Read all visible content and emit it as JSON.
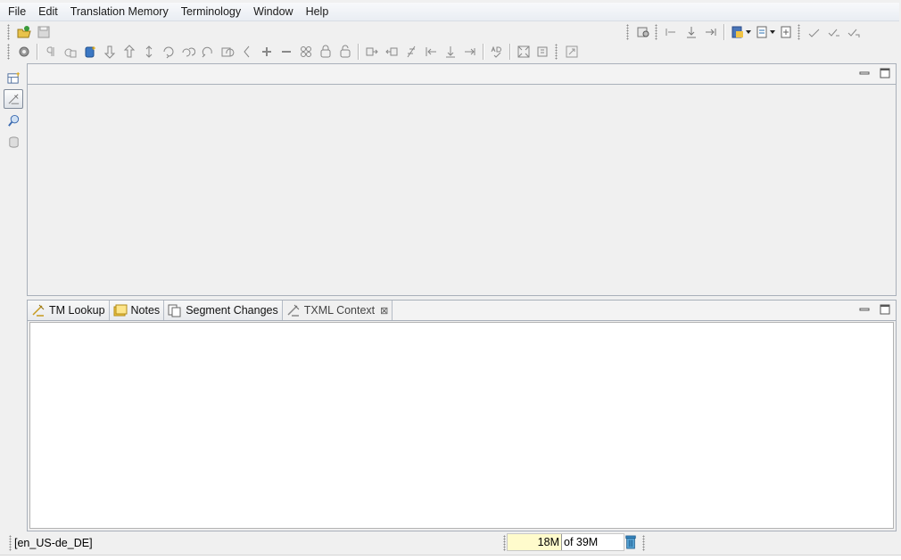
{
  "menu": [
    "File",
    "Edit",
    "Translation Memory",
    "Terminology",
    "Window",
    "Help"
  ],
  "toolbar": {
    "row1_left": [
      "open-project-icon",
      "save-icon"
    ],
    "row1_right": [
      "tm-settings-icon",
      "insert-start-tag-icon",
      "insert-end-tag-icon",
      "insert-tab-icon",
      "document-properties-icon",
      "segment-filter-icon",
      "add-file-icon",
      "check-a-icon",
      "check-b-icon",
      "check-c-icon"
    ],
    "row2": [
      "settings-gear-icon",
      "paragraph-mark-icon",
      "copy-source-icon",
      "database-add-icon",
      "next-segment-icon",
      "previous-segment-icon",
      "goto-segment-icon",
      "translate-segment-icon",
      "autotranslate-icon",
      "accept-translation-icon",
      "confirm-segment-icon",
      "undo-change-icon",
      "add-term-icon",
      "remove-term-icon",
      "lookup-term-icon",
      "lock-segment-icon",
      "unlock-segment-icon",
      "join-segment-icon",
      "split-segment-icon",
      "flag-segment-icon",
      "first-segment-icon",
      "insert-placeholder-icon",
      "next-placeholder-icon",
      "spell-check-icon",
      "fit-window-icon",
      "view-source-icon",
      "resize-icon"
    ]
  },
  "left_bar": [
    "new-view-icon",
    "txml-context-side-icon",
    "search-side-icon",
    "database-side-icon"
  ],
  "bottom_panel": {
    "tabs": [
      {
        "label": "TM Lookup",
        "icon": "tm-lookup-icon"
      },
      {
        "label": "Notes",
        "icon": "notes-icon"
      },
      {
        "label": "Segment Changes",
        "icon": "segment-changes-icon"
      },
      {
        "label": "TXML Context",
        "icon": "txml-context-icon",
        "selected": true,
        "close": "⊠"
      }
    ]
  },
  "status": {
    "locale": "[en_US-de_DE]",
    "heap_used": "18M",
    "heap_total": "of 39M"
  },
  "colors": {
    "heap_bg": "#fffbcc",
    "accent": "#2a7ab0"
  }
}
